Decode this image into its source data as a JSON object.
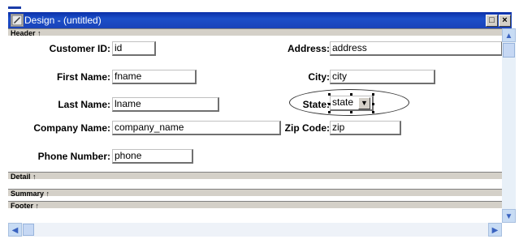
{
  "window": {
    "title": "Design - (untitled)",
    "restore_glyph": "□",
    "close_glyph": "×"
  },
  "bands": {
    "header": "Header ↑",
    "detail": "Detail ↑",
    "summary": "Summary ↑",
    "footer": "Footer ↑"
  },
  "fields": {
    "customer_id": {
      "label": "Customer ID:",
      "value": "id"
    },
    "address": {
      "label": "Address:",
      "value": "address"
    },
    "first_name": {
      "label": "First Name:",
      "value": "fname"
    },
    "city": {
      "label": "City:",
      "value": "city"
    },
    "last_name": {
      "label": "Last Name:",
      "value": "lname"
    },
    "state": {
      "label": "State:",
      "value": "state"
    },
    "company_name": {
      "label": "Company Name:",
      "value": "company_name"
    },
    "zip_code": {
      "label": "Zip Code:",
      "value": "zip"
    },
    "phone_number": {
      "label": "Phone Number:",
      "value": "phone"
    }
  },
  "scroll": {
    "up": "▲",
    "down": "▼",
    "left": "◀",
    "right": "▶"
  },
  "icons": {
    "window": "design-window-icon",
    "dropdown": "chevron-down-icon"
  }
}
